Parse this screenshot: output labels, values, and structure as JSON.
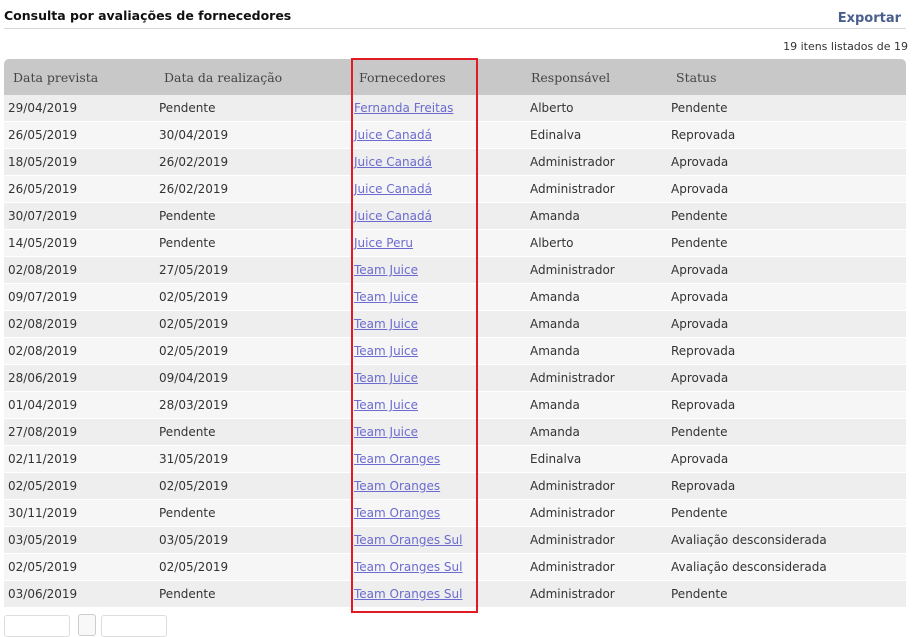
{
  "header": {
    "title": "Consulta por avaliações de fornecedores",
    "export_label": "Exportar",
    "count_label": "19 itens listados de 19"
  },
  "table": {
    "columns": [
      "Data prevista",
      "Data da realização",
      "Fornecedores",
      "Responsável",
      "Status"
    ],
    "rows": [
      [
        "29/04/2019",
        "Pendente",
        "Fernanda Freitas",
        "Alberto",
        "Pendente"
      ],
      [
        "26/05/2019",
        "30/04/2019",
        "Juice Canadá",
        "Edinalva",
        "Reprovada"
      ],
      [
        "18/05/2019",
        "26/02/2019",
        "Juice Canadá",
        "Administrador",
        "Aprovada"
      ],
      [
        "26/05/2019",
        "26/02/2019",
        "Juice Canadá",
        "Administrador",
        "Aprovada"
      ],
      [
        "30/07/2019",
        "Pendente",
        "Juice Canadá",
        "Amanda",
        "Pendente"
      ],
      [
        "14/05/2019",
        "Pendente",
        "Juice Peru",
        "Alberto",
        "Pendente"
      ],
      [
        "02/08/2019",
        "27/05/2019",
        "Team Juice",
        "Administrador",
        "Aprovada"
      ],
      [
        "09/07/2019",
        "02/05/2019",
        "Team Juice",
        "Amanda",
        "Aprovada"
      ],
      [
        "02/08/2019",
        "02/05/2019",
        "Team Juice",
        "Amanda",
        "Aprovada"
      ],
      [
        "02/08/2019",
        "02/05/2019",
        "Team Juice",
        "Amanda",
        "Reprovada"
      ],
      [
        "28/06/2019",
        "09/04/2019",
        "Team Juice",
        "Administrador",
        "Aprovada"
      ],
      [
        "01/04/2019",
        "28/03/2019",
        "Team Juice",
        "Amanda",
        "Reprovada"
      ],
      [
        "27/08/2019",
        "Pendente",
        "Team Juice",
        "Amanda",
        "Pendente"
      ],
      [
        "02/11/2019",
        "31/05/2019",
        "Team Oranges",
        "Edinalva",
        "Aprovada"
      ],
      [
        "02/05/2019",
        "02/05/2019",
        "Team Oranges",
        "Administrador",
        "Reprovada"
      ],
      [
        "30/11/2019",
        "Pendente",
        "Team Oranges",
        "Administrador",
        "Pendente"
      ],
      [
        "03/05/2019",
        "03/05/2019",
        "Team Oranges Sul",
        "Administrador",
        "Avaliação desconsiderada"
      ],
      [
        "02/05/2019",
        "02/05/2019",
        "Team Oranges Sul",
        "Administrador",
        "Avaliação desconsiderada"
      ],
      [
        "03/06/2019",
        "Pendente",
        "Team Oranges Sul",
        "Administrador",
        "Pendente"
      ]
    ]
  },
  "colors": {
    "accent": "#4a5f8e",
    "link": "#6b6bd0",
    "highlight_border": "#e01b24"
  }
}
